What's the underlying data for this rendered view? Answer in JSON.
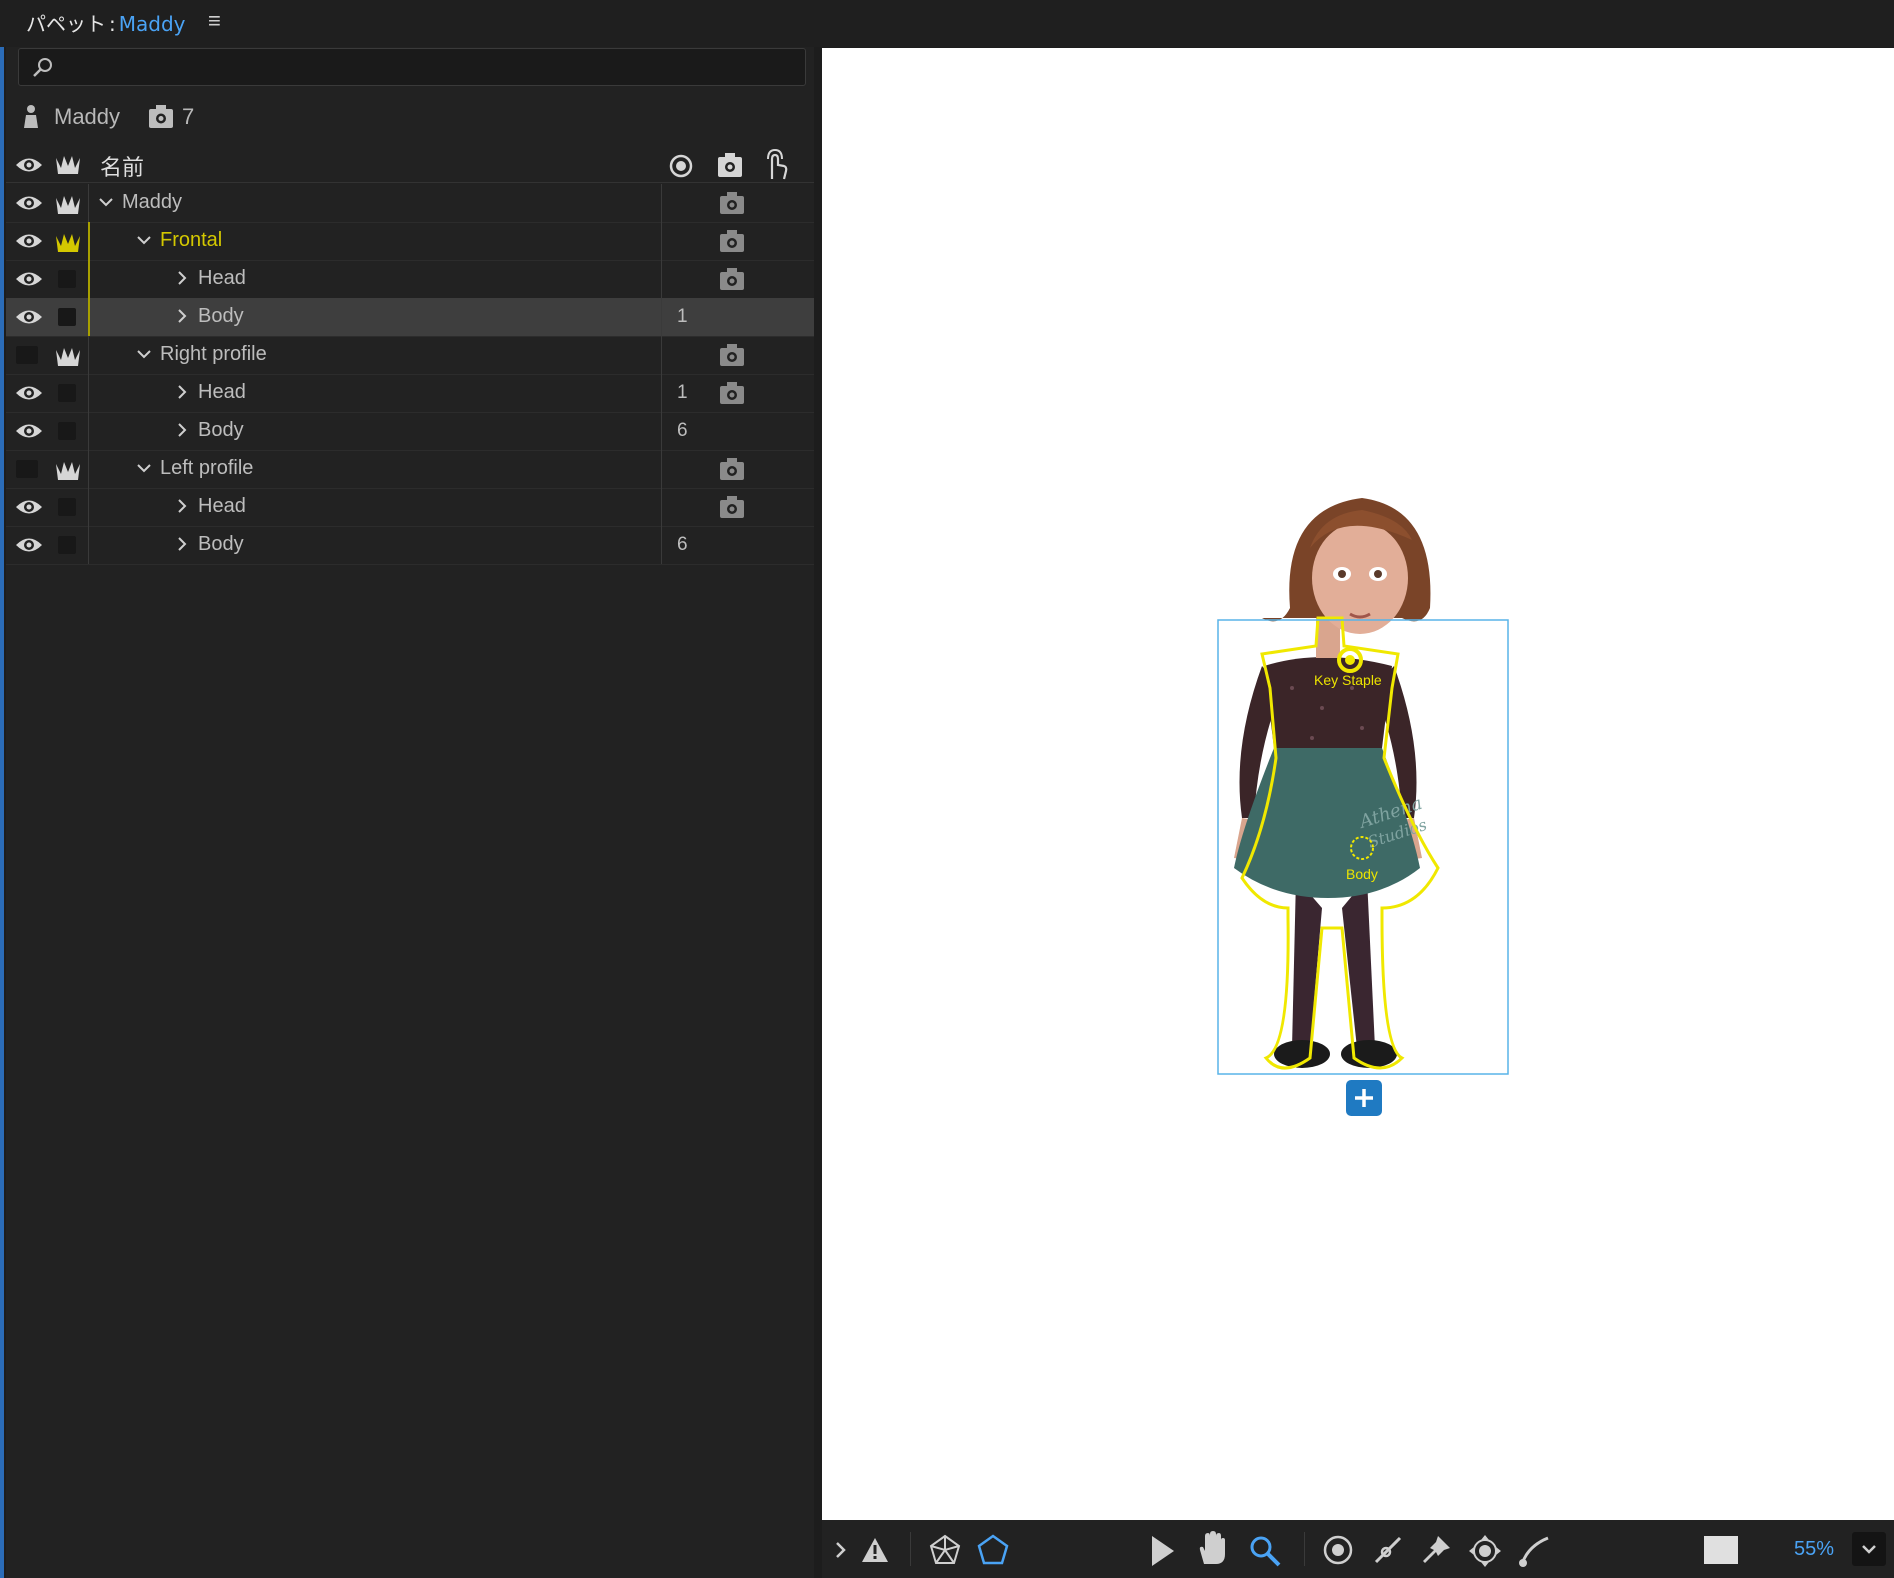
{
  "tab": {
    "title_prefix": "パペット",
    "separator": ":",
    "puppet_name": "Maddy"
  },
  "summary": {
    "puppet_name": "Maddy",
    "behavior_count": "7"
  },
  "columns": {
    "name": "名前"
  },
  "tree": [
    {
      "label": "Maddy",
      "level": 0,
      "expanded": true,
      "visible": true,
      "independent": true,
      "number": "",
      "behaviors": true,
      "highlight": false,
      "selected": false
    },
    {
      "label": "Frontal",
      "level": 1,
      "expanded": true,
      "visible": true,
      "independent": true,
      "number": "",
      "behaviors": true,
      "highlight": true,
      "selected": false
    },
    {
      "label": "Head",
      "level": 2,
      "expanded": false,
      "visible": true,
      "independent": false,
      "number": "",
      "behaviors": true,
      "highlight": false,
      "selected": false
    },
    {
      "label": "Body",
      "level": 2,
      "expanded": false,
      "visible": true,
      "independent": false,
      "number": "1",
      "behaviors": false,
      "highlight": false,
      "selected": true
    },
    {
      "label": "Right profile",
      "level": 1,
      "expanded": true,
      "visible": false,
      "independent": true,
      "number": "",
      "behaviors": true,
      "highlight": false,
      "selected": false
    },
    {
      "label": "Head",
      "level": 2,
      "expanded": false,
      "visible": true,
      "independent": false,
      "number": "1",
      "behaviors": true,
      "highlight": false,
      "selected": false
    },
    {
      "label": "Body",
      "level": 2,
      "expanded": false,
      "visible": true,
      "independent": false,
      "number": "6",
      "behaviors": false,
      "highlight": false,
      "selected": false
    },
    {
      "label": "Left profile",
      "level": 1,
      "expanded": true,
      "visible": false,
      "independent": true,
      "number": "",
      "behaviors": true,
      "highlight": false,
      "selected": false
    },
    {
      "label": "Head",
      "level": 2,
      "expanded": false,
      "visible": true,
      "independent": false,
      "number": "",
      "behaviors": true,
      "highlight": false,
      "selected": false
    },
    {
      "label": "Body",
      "level": 2,
      "expanded": false,
      "visible": true,
      "independent": false,
      "number": "6",
      "behaviors": false,
      "highlight": false,
      "selected": false
    }
  ],
  "canvas": {
    "handle_key_staple": "Key Staple",
    "handle_body": "Body"
  },
  "toolbar": {
    "zoom": "55%",
    "tools": [
      "expand-icon",
      "warning-icon",
      "mesh-icon",
      "outline-icon",
      "selection-tool-icon",
      "hand-tool-icon",
      "zoom-tool-icon",
      "handle-tool-icon",
      "stick-tool-icon",
      "pin-tool-icon",
      "dragger-tool-icon",
      "draw-tool-icon"
    ],
    "accent": "#4aa3f5"
  },
  "colors": {
    "highlight_yellow": "#d4c800",
    "accent_blue": "#4aa3f5",
    "selection_box": "#58b4e8"
  }
}
